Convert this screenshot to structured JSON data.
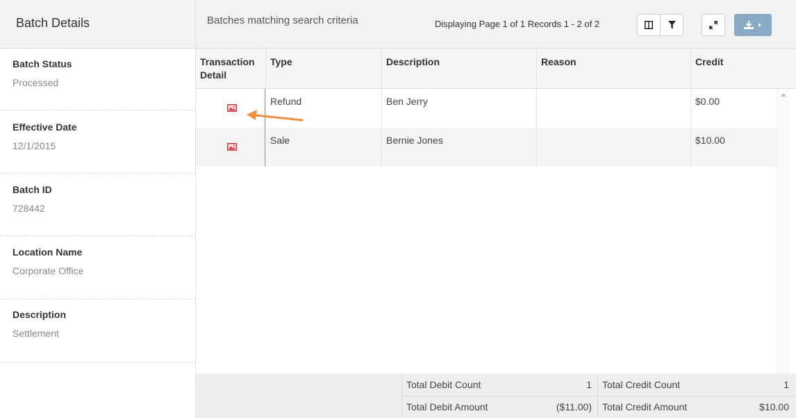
{
  "left": {
    "header": "Batch Details",
    "fields": [
      {
        "label": "Batch Status",
        "value": "Processed"
      },
      {
        "label": "Effective Date",
        "value": "12/1/2015"
      },
      {
        "label": "Batch ID",
        "value": "728442"
      },
      {
        "label": "Location Name",
        "value": "Corporate Office"
      },
      {
        "label": "Description",
        "value": "Settlement"
      }
    ]
  },
  "toolbar": {
    "title": "Batches matching search criteria",
    "paging": "Displaying Page 1 of 1 Records 1 - 2 of 2",
    "icons": {
      "columns": "columns-icon",
      "filter": "filter-icon",
      "expand": "expand-icon",
      "export": "download-icon"
    }
  },
  "table": {
    "headers": [
      "Transaction Detail",
      "Type",
      "Description",
      "Reason",
      "Credit"
    ],
    "rows": [
      {
        "icon": "image-icon",
        "type": "Refund",
        "description": "Ben Jerry",
        "reason": "",
        "credit": "$0.00"
      },
      {
        "icon": "image-icon",
        "type": "Sale",
        "description": "Bernie Jones",
        "reason": "",
        "credit": "$10.00"
      }
    ]
  },
  "summary": {
    "total_debit_count_label": "Total Debit Count",
    "total_debit_count": "1",
    "total_credit_count_label": "Total Credit Count",
    "total_credit_count": "1",
    "total_debit_amount_label": "Total Debit Amount",
    "total_debit_amount": "($11.00)",
    "total_credit_amount_label": "Total Credit Amount",
    "total_credit_amount": "$10.00"
  },
  "colors": {
    "accent_arrow": "#f0913f",
    "image_icon": "#d9363e",
    "export_button": "#8aa9c4"
  }
}
